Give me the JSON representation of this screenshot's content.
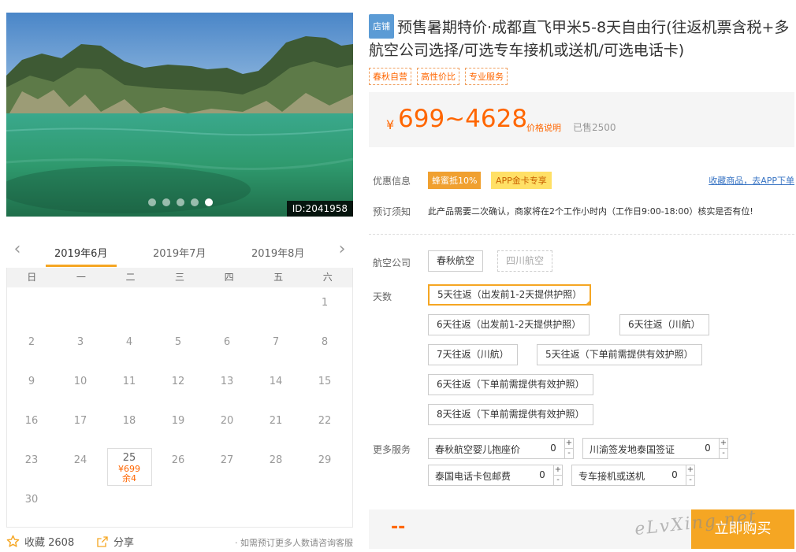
{
  "gallery": {
    "id_label": "ID:2041958",
    "dot_count": 5,
    "active_dot": 4
  },
  "calendar": {
    "prev_icon": "chevron-left-icon",
    "next_icon": "chevron-right-icon",
    "months": [
      "2019年6月",
      "2019年7月",
      "2019年8月"
    ],
    "active_month": 0,
    "weekdays": [
      "日",
      "一",
      "二",
      "三",
      "四",
      "五",
      "六"
    ],
    "first_weekday": 6,
    "days_in_month": 30,
    "special_day": {
      "day": "25",
      "price": "¥699",
      "remain": "余4"
    }
  },
  "actions": {
    "favorite_label": "收藏 2608",
    "share_label": "分享",
    "consult_text": "· 如需预订更多人数请咨询客服"
  },
  "product": {
    "shop_tag": "店铺",
    "title": "预售暑期特价·成都直飞甲米5-8天自由行(往返机票含税+多航空公司选择/可选专车接机或送机/可选电话卡)",
    "tags": [
      "春秋自营",
      "高性价比",
      "专业服务"
    ]
  },
  "price": {
    "currency": "¥",
    "range": "699~4628",
    "note": "价格说明",
    "sold": "已售2500"
  },
  "promo": {
    "label": "优惠信息",
    "badge1": "蜂蜜抵10%",
    "badge2": "APP金卡专享",
    "link": "收藏商品，去APP下单"
  },
  "notice": {
    "label": "预订须知",
    "text": "此产品需要二次确认，商家将在2个工作小时内（工作日9:00-18:00）核实是否有位!"
  },
  "airline": {
    "label": "航空公司",
    "options": [
      "春秋航空",
      "四川航空"
    ]
  },
  "days": {
    "label": "天数",
    "options": [
      "5天往返（出发前1-2天提供护照）",
      "6天往返（出发前1-2天提供护照）",
      "6天往返（川航）",
      "7天往返（川航）",
      "5天往返（下单前需提供有效护照）",
      "6天往返（下单前需提供有效护照）",
      "8天往返（下单前需提供有效护照）"
    ]
  },
  "services": {
    "label": "更多服务",
    "items": [
      {
        "label": "春秋航空婴儿抱座价",
        "count": "0"
      },
      {
        "label": "川渝签发地泰国签证",
        "count": "0"
      },
      {
        "label": "泰国电话卡包邮费",
        "count": "0"
      },
      {
        "label": "专车接机或送机",
        "count": "0"
      }
    ],
    "plus": "+",
    "minus": "-"
  },
  "buy": {
    "total": "--",
    "button": "立即购买"
  },
  "watermark": "eLvXing.net",
  "colors": {
    "accent": "#f5a623",
    "price": "#ff6600",
    "link": "#3a75c4",
    "shop_tag": "#5b9bd5"
  }
}
